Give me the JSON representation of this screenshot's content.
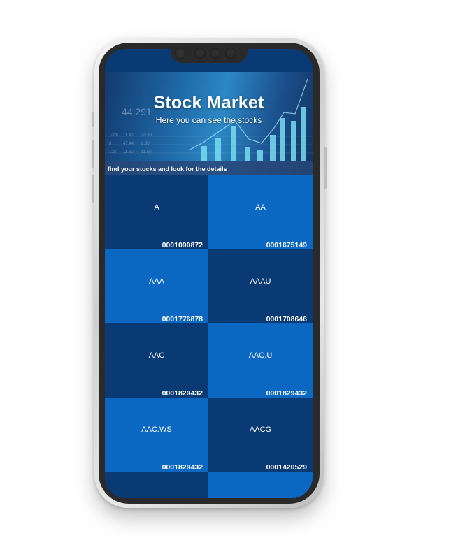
{
  "hero": {
    "title": "Stock Market",
    "subtitle": "Here you can see the stocks",
    "caption": "find your stocks and look for the details"
  },
  "stocks": [
    {
      "symbol": "A",
      "cik": "0001090872"
    },
    {
      "symbol": "AA",
      "cik": "0001675149"
    },
    {
      "symbol": "AAA",
      "cik": "0001776878"
    },
    {
      "symbol": "AAAU",
      "cik": "0001708646"
    },
    {
      "symbol": "AAC",
      "cik": "0001829432"
    },
    {
      "symbol": "AAC.U",
      "cik": "0001829432"
    },
    {
      "symbol": "AAC.WS",
      "cik": "0001829432"
    },
    {
      "symbol": "AACG",
      "cik": "0001420529"
    },
    {
      "symbol": "",
      "cik": ""
    },
    {
      "symbol": "",
      "cik": ""
    }
  ],
  "colors": {
    "dark_tile": "#0a3a73",
    "light_tile": "#0a67c2",
    "phone_bezel": "#2a2a2a"
  }
}
